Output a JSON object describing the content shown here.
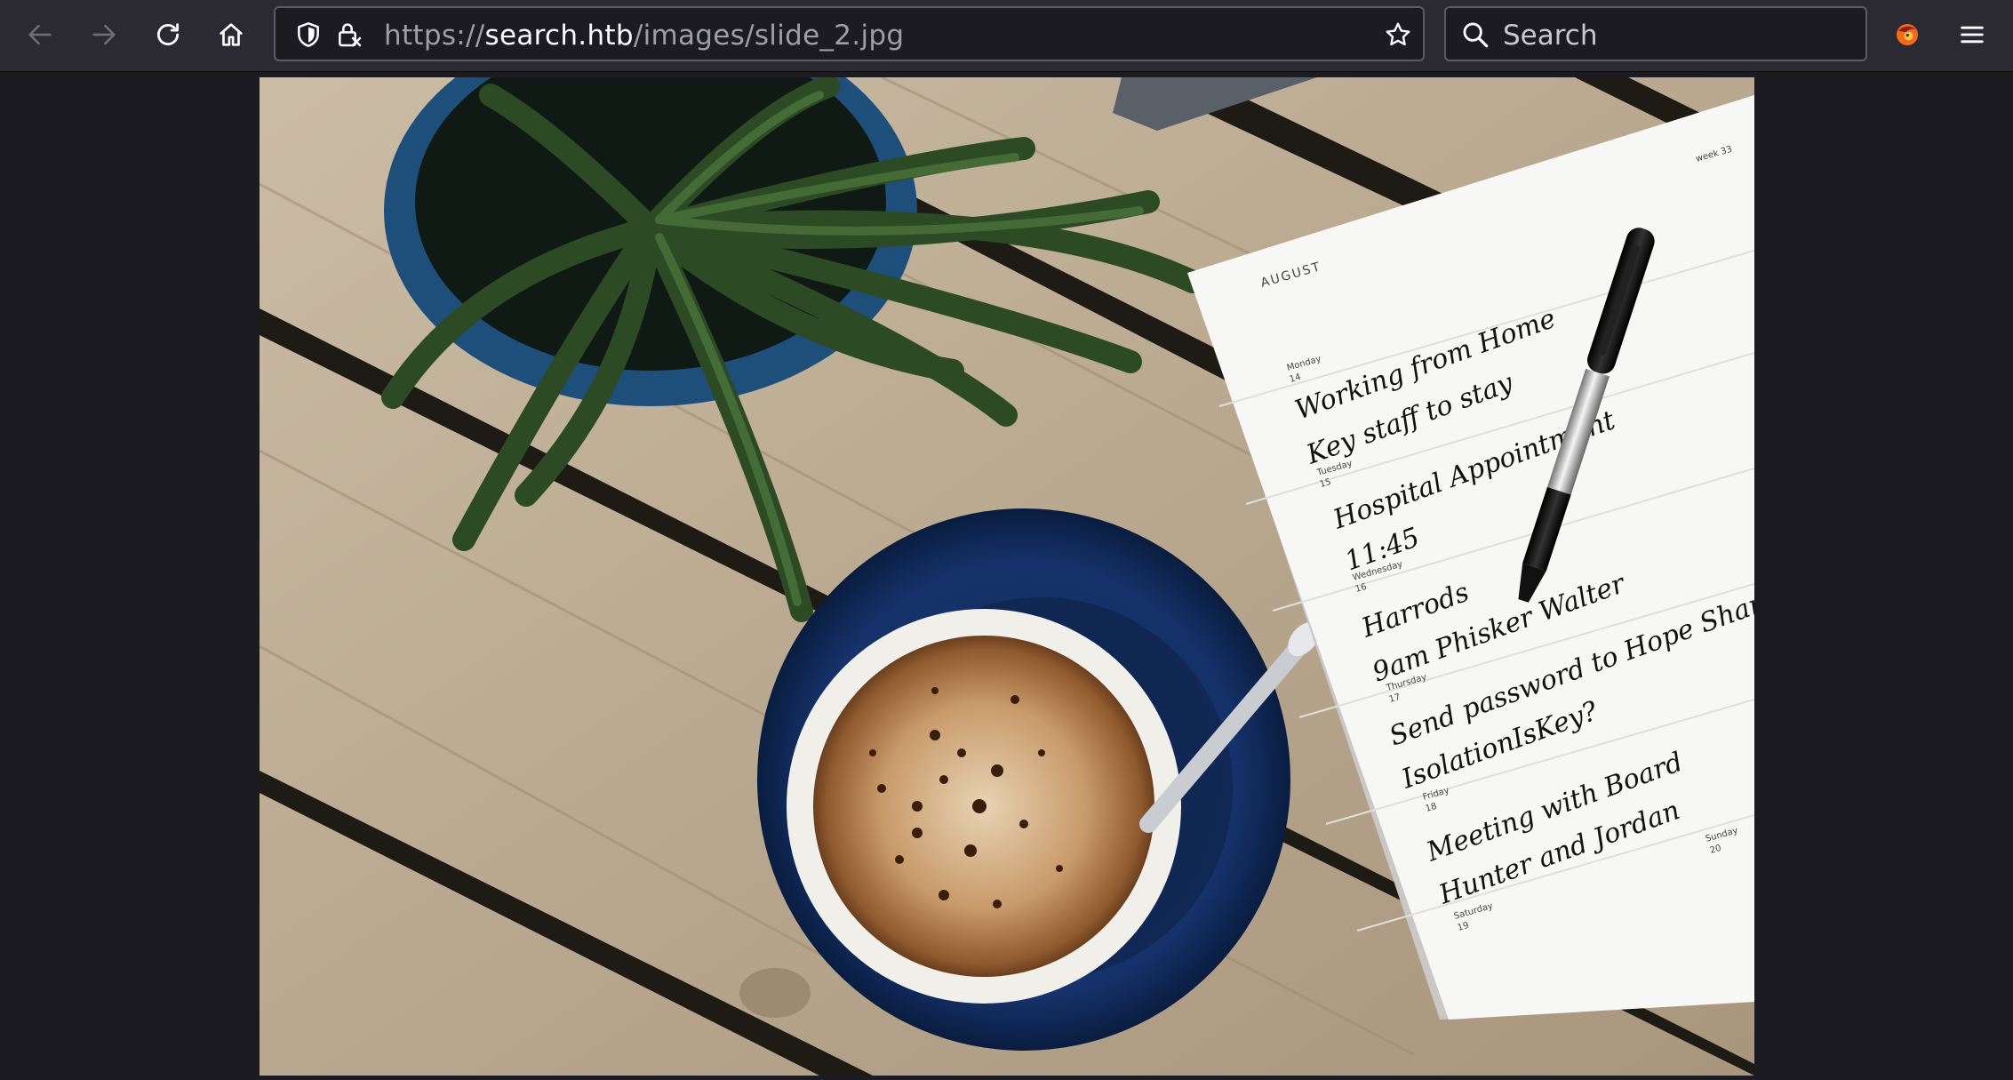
{
  "toolbar": {
    "back_icon": "arrow-left-icon",
    "forward_icon": "arrow-right-icon",
    "reload_icon": "reload-icon",
    "home_icon": "home-icon",
    "menu_icon": "hamburger-menu-icon",
    "extension_icon": "browser-extension-icon"
  },
  "url": {
    "scheme": "https://",
    "host": "search.htb",
    "path": "/images/slide_2.jpg",
    "tracking_icon": "shield-icon",
    "lock_icon": "lock-icon",
    "bookmark_icon": "star-icon"
  },
  "search": {
    "placeholder": "Search",
    "icon": "search-icon"
  },
  "planner": {
    "month": "AUGUST",
    "week": "week 33",
    "days": [
      {
        "day": "Monday",
        "date": "14"
      },
      {
        "day": "Tuesday",
        "date": "15"
      },
      {
        "day": "Wednesday",
        "date": "16"
      },
      {
        "day": "Thursday",
        "date": "17"
      },
      {
        "day": "Friday",
        "date": "18"
      },
      {
        "day": "Saturday",
        "date": "19"
      },
      {
        "day": "Sunday",
        "date": "20"
      }
    ],
    "notes": [
      "Working from Home",
      "Key staff to stay",
      "Hospital Appointment",
      "11:45",
      "Harrods",
      "9am Phisker Walter",
      "Send password to Hope Sharp",
      "IsolationIsKey?",
      "Meeting with Board",
      "Hunter and Jordan"
    ]
  },
  "colors": {
    "toolbar_bg": "#2b2a33",
    "page_bg": "#1c1b22",
    "url_text": "#fbfbfe",
    "url_dim": "#9e9ea6"
  }
}
